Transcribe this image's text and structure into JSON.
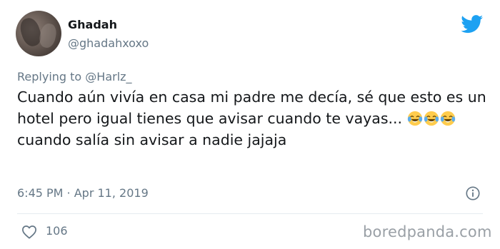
{
  "author": {
    "display_name": "Ghadah",
    "handle": "@ghadahxoxo"
  },
  "reply": {
    "prefix": "Replying to",
    "mention": "@Harlz_"
  },
  "tweet": {
    "text_part1": "Cuando aún vivía en casa mi padre me decía, sé que esto es un hotel pero igual tienes que avisar cuando te vayas...",
    "emojis": [
      "face-with-tears-of-joy",
      "face-with-tears-of-joy",
      "face-with-tears-of-joy"
    ],
    "text_part2": "cuando salía sin avisar a nadie jajaja",
    "timestamp": "6:45 PM · Apr 11, 2019",
    "likes": "106"
  },
  "icons": {
    "brand": "twitter-bird-icon",
    "info": "info-icon",
    "like": "heart-icon"
  },
  "colors": {
    "twitter_blue": "#1da1f2",
    "secondary_text": "#657786",
    "primary_text": "#14171a",
    "watermark": "#9aa0a6"
  },
  "watermark": "boredpanda.com"
}
